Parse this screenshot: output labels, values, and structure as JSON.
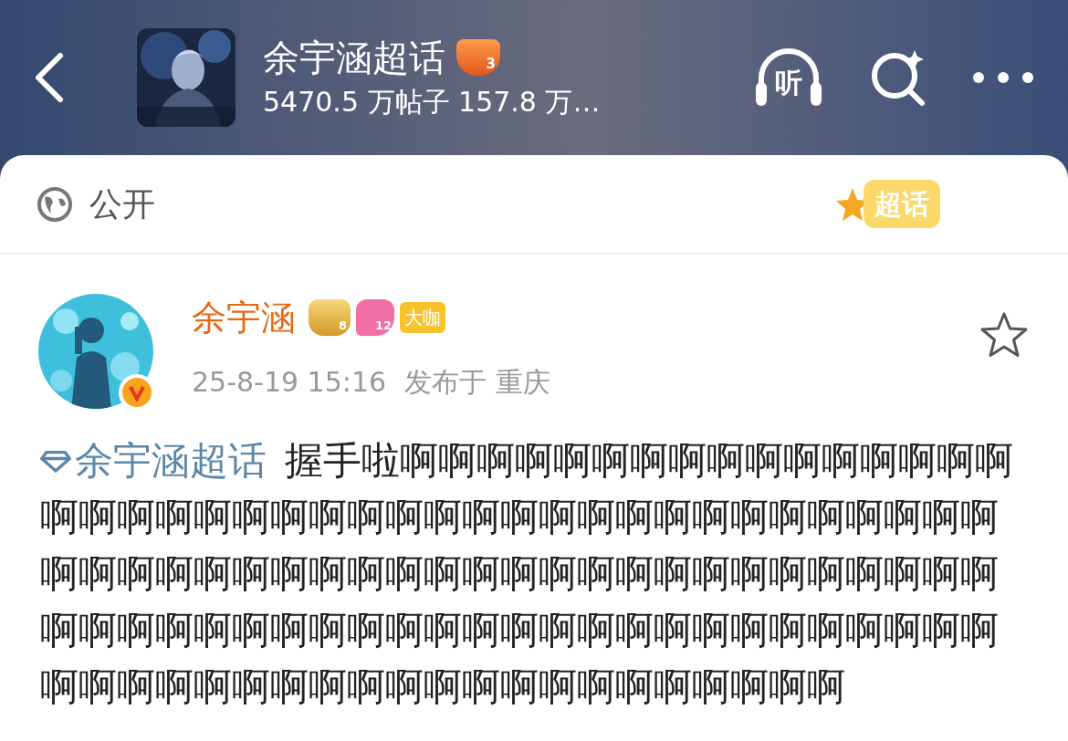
{
  "header": {
    "title": "余宇涵超话",
    "level_badge": "3",
    "stats": "5470.5 万帖子 157.8 万…",
    "listen_label": "听"
  },
  "visibility": {
    "label": "公开",
    "sticker": "超话"
  },
  "post": {
    "author": "余宇涵",
    "badges": [
      {
        "kind": "crown",
        "label": "8"
      },
      {
        "kind": "gem",
        "label": "12"
      },
      {
        "kind": "tag",
        "label": "大咖"
      }
    ],
    "verified": true,
    "favorited": false,
    "time": "25-8-19 15:16",
    "location": "发布于 重庆",
    "topic": "余宇涵超话",
    "text": "握手啦啊啊啊啊啊啊啊啊啊啊啊啊啊啊啊啊啊啊啊啊啊啊啊啊啊啊啊啊啊啊啊啊啊啊啊啊啊啊啊啊啊啊啊啊啊啊啊啊啊啊啊啊啊啊啊啊啊啊啊啊啊啊啊啊啊啊啊啊啊啊啊啊啊啊啊啊啊啊啊啊啊啊啊啊啊啊啊啊啊啊啊啊啊啊啊啊啊啊啊啊啊啊啊啊啊啊啊啊啊啊啊啊"
  }
}
